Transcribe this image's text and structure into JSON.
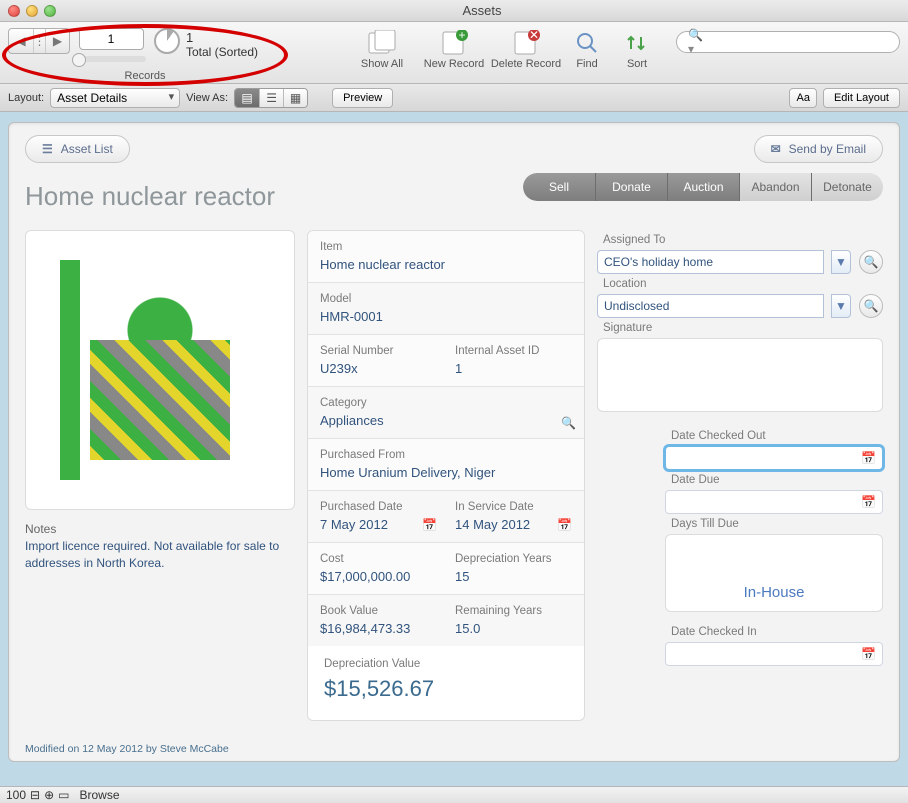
{
  "window": {
    "title": "Assets"
  },
  "toolbar1": {
    "record_number": "1",
    "total_count": "1",
    "total_status": "Total (Sorted)",
    "records_label": "Records",
    "showall": "Show All",
    "newrecord": "New Record",
    "deleterecord": "Delete Record",
    "find": "Find",
    "sort": "Sort",
    "search_placeholder": ""
  },
  "toolbar2": {
    "layout_label": "Layout:",
    "layout_value": "Asset Details",
    "viewas_label": "View As:",
    "preview": "Preview",
    "aa": "Aa",
    "editlayout": "Edit Layout"
  },
  "header": {
    "assetlist": "Asset List",
    "sendemail": "Send by Email"
  },
  "asset": {
    "name": "Home nuclear reactor",
    "tabs": [
      "Sell",
      "Donate",
      "Auction",
      "Abandon",
      "Detonate"
    ],
    "notes_label": "Notes",
    "notes": "Import licence required. Not available for sale to addresses in North Korea.",
    "fields": {
      "item_label": "Item",
      "item": "Home nuclear reactor",
      "model_label": "Model",
      "model": "HMR-0001",
      "serial_label": "Serial Number",
      "serial": "U239x",
      "internalid_label": "Internal Asset ID",
      "internalid": "1",
      "category_label": "Category",
      "category": "Appliances",
      "purchasedfrom_label": "Purchased From",
      "purchasedfrom": "Home Uranium Delivery, Niger",
      "purchasedate_label": "Purchased Date",
      "purchasedate": "7 May 2012",
      "inservice_label": "In Service Date",
      "inservice": "14 May 2012",
      "cost_label": "Cost",
      "cost": "$17,000,000.00",
      "depyears_label": "Depreciation Years",
      "depyears": "15",
      "book_label": "Book Value",
      "book": "$16,984,473.33",
      "remyears_label": "Remaining Years",
      "remyears": "15.0",
      "depval_label": "Depreciation Value",
      "depval": "$15,526.67"
    },
    "right": {
      "assigned_label": "Assigned To",
      "assigned": "CEO's holiday home",
      "location_label": "Location",
      "location": "Undisclosed",
      "signature_label": "Signature",
      "checkedout_label": "Date Checked Out",
      "checkedout": "",
      "due_label": "Date Due",
      "due": "",
      "daystill_label": "Days Till Due",
      "inhouse": "In-House",
      "checkedin_label": "Date Checked In",
      "checkedin": ""
    }
  },
  "footer": {
    "modified": "Modified on 12 May 2012 by Steve McCabe"
  },
  "status": {
    "zoom": "100",
    "mode": "Browse"
  }
}
